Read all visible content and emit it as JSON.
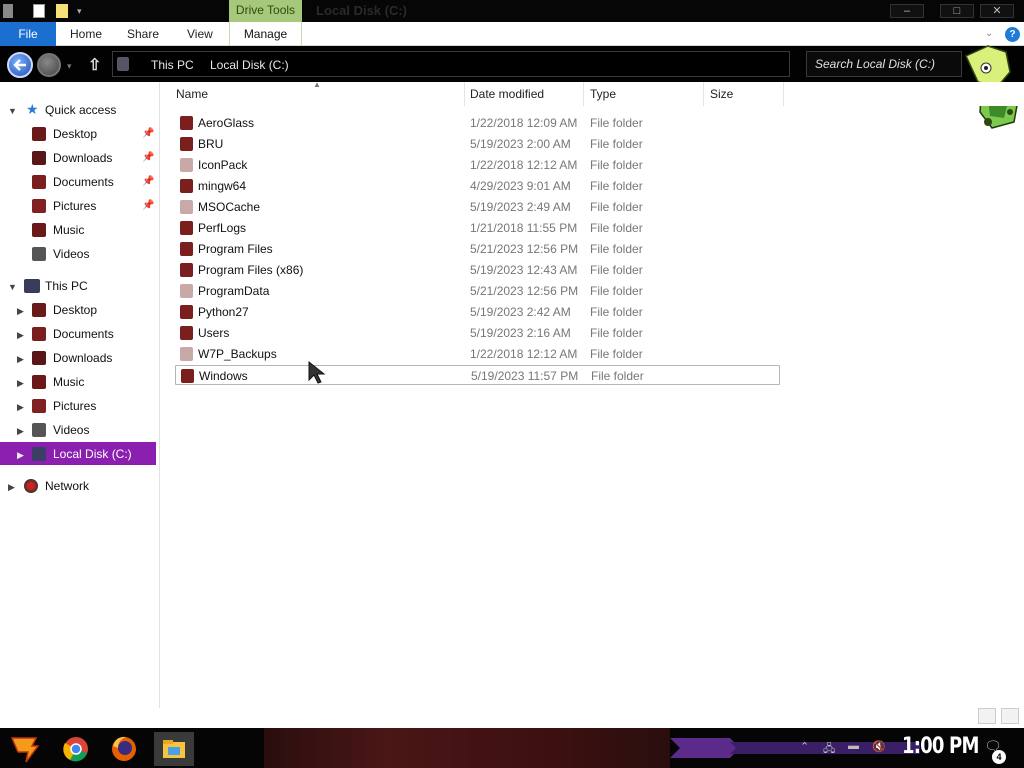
{
  "window": {
    "title": "Local Disk (C:)",
    "contextual_tab_group": "Drive Tools",
    "controls": {
      "minimize": "–",
      "maximize": "□",
      "close": "✕"
    }
  },
  "ribbon": {
    "tabs": [
      {
        "label": "File"
      },
      {
        "label": "Home"
      },
      {
        "label": "Share"
      },
      {
        "label": "View"
      },
      {
        "label": "Manage"
      }
    ],
    "help": "?"
  },
  "address_bar": {
    "breadcrumbs": [
      "This PC",
      "Local Disk (C:)"
    ],
    "search_placeholder": "Search Local Disk (C:)"
  },
  "navigation_pane": {
    "quick_access": {
      "label": "Quick access",
      "items": [
        {
          "label": "Desktop",
          "pinned": true
        },
        {
          "label": "Downloads",
          "pinned": true
        },
        {
          "label": "Documents",
          "pinned": true
        },
        {
          "label": "Pictures",
          "pinned": true
        },
        {
          "label": "Music",
          "pinned": false
        },
        {
          "label": "Videos",
          "pinned": false
        }
      ]
    },
    "this_pc": {
      "label": "This PC",
      "items": [
        {
          "label": "Desktop"
        },
        {
          "label": "Documents"
        },
        {
          "label": "Downloads"
        },
        {
          "label": "Music"
        },
        {
          "label": "Pictures"
        },
        {
          "label": "Videos"
        },
        {
          "label": "Local Disk (C:)",
          "selected": true
        }
      ]
    },
    "network": {
      "label": "Network"
    }
  },
  "file_list": {
    "columns": [
      "Name",
      "Date modified",
      "Type",
      "Size"
    ],
    "rows": [
      {
        "name": "AeroGlass",
        "date": "1/22/2018 12:09 AM",
        "type": "File folder",
        "icon": "folder-dark"
      },
      {
        "name": "BRU",
        "date": "5/19/2023 2:00 AM",
        "type": "File folder",
        "icon": "folder-dark"
      },
      {
        "name": "IconPack",
        "date": "1/22/2018 12:12 AM",
        "type": "File folder",
        "icon": "folder-faded"
      },
      {
        "name": "mingw64",
        "date": "4/29/2023 9:01 AM",
        "type": "File folder",
        "icon": "folder-dark"
      },
      {
        "name": "MSOCache",
        "date": "5/19/2023 2:49 AM",
        "type": "File folder",
        "icon": "folder-faded"
      },
      {
        "name": "PerfLogs",
        "date": "1/21/2018 11:55 PM",
        "type": "File folder",
        "icon": "folder-dark"
      },
      {
        "name": "Program Files",
        "date": "5/21/2023 12:56 PM",
        "type": "File folder",
        "icon": "folder-dark"
      },
      {
        "name": "Program Files (x86)",
        "date": "5/19/2023 12:43 AM",
        "type": "File folder",
        "icon": "folder-dark"
      },
      {
        "name": "ProgramData",
        "date": "5/21/2023 12:56 PM",
        "type": "File folder",
        "icon": "folder-faded"
      },
      {
        "name": "Python27",
        "date": "5/19/2023 2:42 AM",
        "type": "File folder",
        "icon": "folder-dark"
      },
      {
        "name": "Users",
        "date": "5/19/2023 2:16 AM",
        "type": "File folder",
        "icon": "folder-dark"
      },
      {
        "name": "W7P_Backups",
        "date": "1/22/2018 12:12 AM",
        "type": "File folder",
        "icon": "folder-faded"
      },
      {
        "name": "Windows",
        "date": "5/19/2023 11:57 PM",
        "type": "File folder",
        "icon": "folder-dark",
        "selected": true
      }
    ]
  },
  "taskbar": {
    "apps": [
      "start-icon",
      "chrome-icon",
      "firefox-icon",
      "file-explorer-icon"
    ],
    "clock": "1:00 PM",
    "notification_count": "4"
  },
  "colors": {
    "accent_blue": "#1a6fd0",
    "nav_selected": "#8a1fb0",
    "drive_tools": "#a6c87a",
    "title_bar": "#060606",
    "folder_dark": "#7a1e1e",
    "folder_faded": "#c9a8a8"
  }
}
